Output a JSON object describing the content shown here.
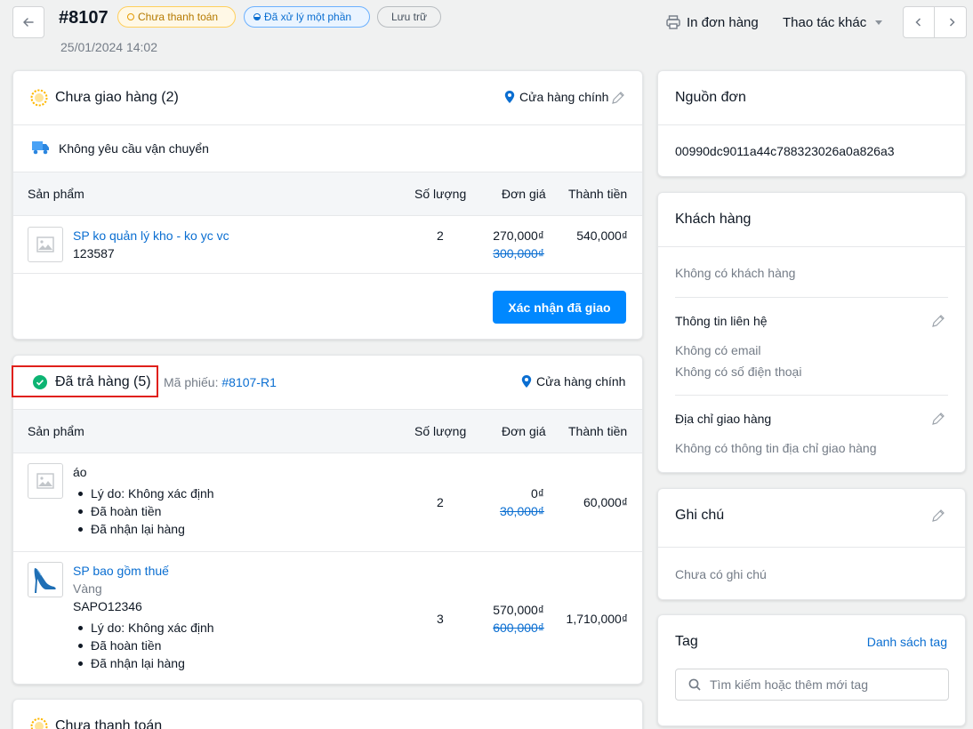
{
  "header": {
    "order_id": "#8107",
    "badge_payment": "Chưa thanh toán",
    "badge_fulfill": "Đã xử lý một phần",
    "badge_archive": "Lưu trữ",
    "datetime": "25/01/2024 14:02",
    "print_label": "In đơn hàng",
    "more_actions_label": "Thao tác khác"
  },
  "unfulfilled": {
    "title": "Chưa giao hàng (2)",
    "location": "Cửa hàng chính",
    "shipping_note": "Không yêu cầu vận chuyển",
    "columns": [
      "Sản phẩm",
      "Số lượng",
      "Đơn giá",
      "Thành tiền"
    ],
    "item": {
      "name": "SP ko quản lý kho - ko yc vc",
      "sku": "123587",
      "qty": "2",
      "price": "270,000₫",
      "orig_price": "300,000₫",
      "total": "540,000₫"
    },
    "confirm_button": "Xác nhận đã giao"
  },
  "returned": {
    "title": "Đã trả hàng (5)",
    "code_label": "Mã phiếu:",
    "code": "#8107-R1",
    "location": "Cửa hàng chính",
    "columns": [
      "Sản phẩm",
      "Số lượng",
      "Đơn giá",
      "Thành tiền"
    ],
    "items": [
      {
        "name": "áo",
        "bullets": [
          "Lý do: Không xác định",
          "Đã hoàn tiền",
          "Đã nhận lại hàng"
        ],
        "qty": "2",
        "price": "0₫",
        "orig_price": "30,000₫",
        "total": "60,000₫"
      },
      {
        "name": "SP bao gồm thuế",
        "variant": "Vàng",
        "sku": "SAPO12346",
        "bullets": [
          "Lý do: Không xác định",
          "Đã hoàn tiền",
          "Đã nhận lại hàng"
        ],
        "qty": "3",
        "price": "570,000₫",
        "orig_price": "600,000₫",
        "total": "1,710,000₫"
      }
    ]
  },
  "payment": {
    "title": "Chưa thanh toán"
  },
  "source": {
    "title": "Nguồn đơn",
    "value": "00990dc9011a44c788323026a0a826a3"
  },
  "customer": {
    "title": "Khách hàng",
    "none": "Không có khách hàng",
    "contact_title": "Thông tin liên hệ",
    "no_email": "Không có email",
    "no_phone": "Không có số điện thoại",
    "address_title": "Địa chỉ giao hàng",
    "no_address": "Không có thông tin địa chỉ giao hàng"
  },
  "note": {
    "title": "Ghi chú",
    "empty": "Chưa có ghi chú"
  },
  "tags": {
    "title": "Tag",
    "list_link": "Danh sách tag",
    "search_placeholder": "Tìm kiếm hoặc thêm mới tag"
  },
  "colors": {
    "accent": "#0a6ed1",
    "button": "#0088ff",
    "highlight": "#e0201b",
    "success": "#0db473",
    "warning": "#ffb800"
  }
}
